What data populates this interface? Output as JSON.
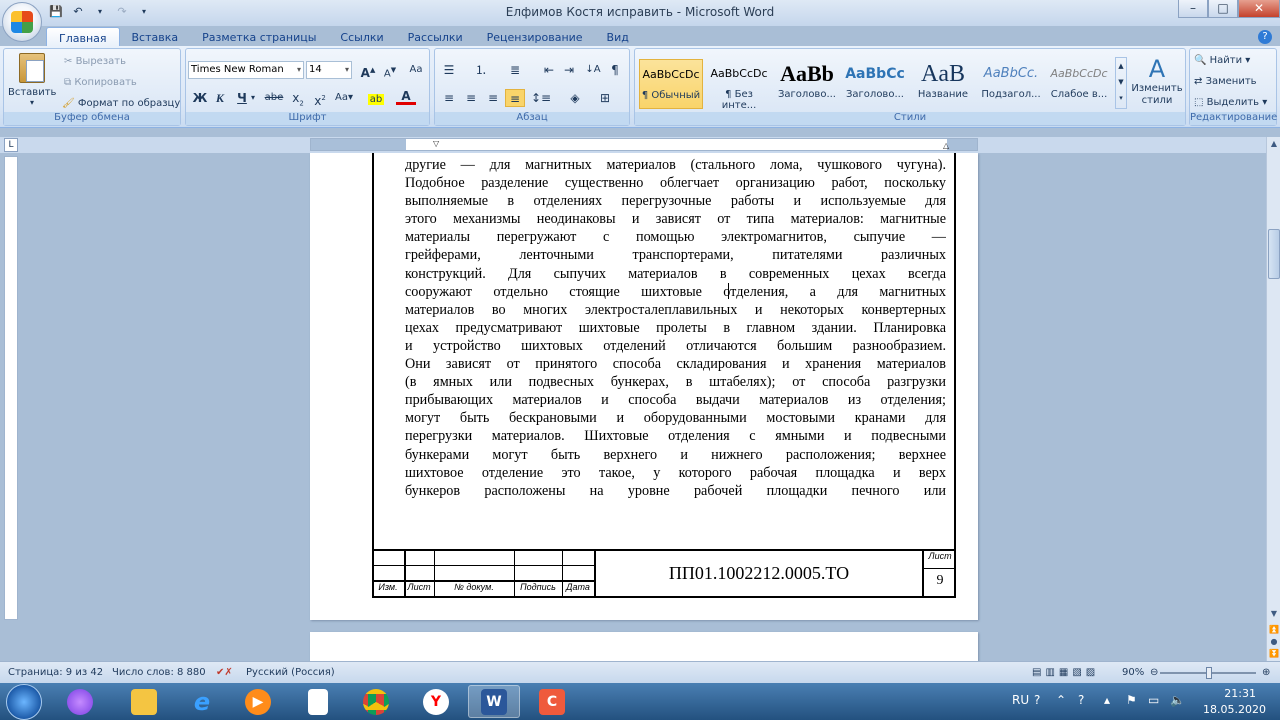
{
  "window": {
    "title": "Елфимов Костя исправить - Microsoft Word",
    "minimize": "–",
    "maximize": "□",
    "close": "✕"
  },
  "tabs": [
    "Главная",
    "Вставка",
    "Разметка страницы",
    "Ссылки",
    "Рассылки",
    "Рецензирование",
    "Вид"
  ],
  "ribbon": {
    "clipboard": {
      "label": "Буфер обмена",
      "paste": "Вставить",
      "cut": "Вырезать",
      "copy": "Копировать",
      "format_painter": "Формат по образцу"
    },
    "font": {
      "label": "Шрифт",
      "family": "Times New Roman",
      "size": "14"
    },
    "paragraph": {
      "label": "Абзац"
    },
    "styles": {
      "label": "Стили",
      "items": [
        {
          "sample": "AaBbCcDc",
          "name": "¶ Обычный"
        },
        {
          "sample": "AaBbCcDc",
          "name": "¶ Без инте..."
        },
        {
          "sample": "AaBb",
          "name": "Заголово..."
        },
        {
          "sample": "AaBbCc",
          "name": "Заголово..."
        },
        {
          "sample": "AaB",
          "name": "Название"
        },
        {
          "sample": "AaBbCc.",
          "name": "Подзагол..."
        },
        {
          "sample": "AaBbCcDc",
          "name": "Слабое в..."
        }
      ],
      "change_styles": "Изменить стили"
    },
    "editing": {
      "label": "Редактирование",
      "find": "Найти",
      "replace": "Заменить",
      "select": "Выделить"
    }
  },
  "document": {
    "lines": [
      "другие — для магнитных материалов (стального лома, чушкового чугуна).",
      "Подобное разделение существенно облегчает организацию работ, поскольку",
      "выполняемые в отделениях перегрузочные работы и используемые для",
      "этого механизмы неодинаковы и зависят от типа материалов: магнитные",
      "материалы перегружают с помощью электромагнитов, сыпучие —",
      "грейферами, ленточными транспортерами, питателями различных",
      "конструкций. Для сыпучих материалов в современных цехах всегда",
      "сооружают отдельно стоящие шихтовые отделения, а для магнитных",
      "материалов во многих электросталеплавильных и некоторых конвертерных",
      "цехах предусматривают шихтовые пролеты в главном здании. Планировка",
      "и устройство шихтовых отделений отличаются большим разнообразием.",
      "Они зависят от принятого способа складирования и хранения материалов",
      "(в ямных или подвесных бункерах, в штабелях); от способа разгрузки",
      "прибывающих материалов и способа выдачи материалов из отделения;",
      "могут быть бескрановыми и оборудованными мостовыми кранами для",
      "перегрузки материалов. Шихтовые отделения с ямными и подвесными",
      "бункерами могут быть верхнего и нижнего расположения; верхнее",
      "шихтовое отделение это такое, у которого рабочая площадка и верх",
      "бункеров расположены на уровне рабочей площадки печного или"
    ],
    "stamp": {
      "cols": [
        "Изм.",
        "Лист",
        "№ докум.",
        "Подпись",
        "Дата"
      ],
      "code": "ПП01.1002212.0005.ТО",
      "sheet_label": "Лист",
      "sheet_number": "9"
    }
  },
  "statusbar": {
    "page": "Страница: 9 из 42",
    "words": "Число слов: 8 880",
    "language": "Русский (Россия)",
    "zoom": "90%"
  },
  "taskbar": {
    "lang": "RU",
    "time": "21:31",
    "date": "18.05.2020"
  }
}
